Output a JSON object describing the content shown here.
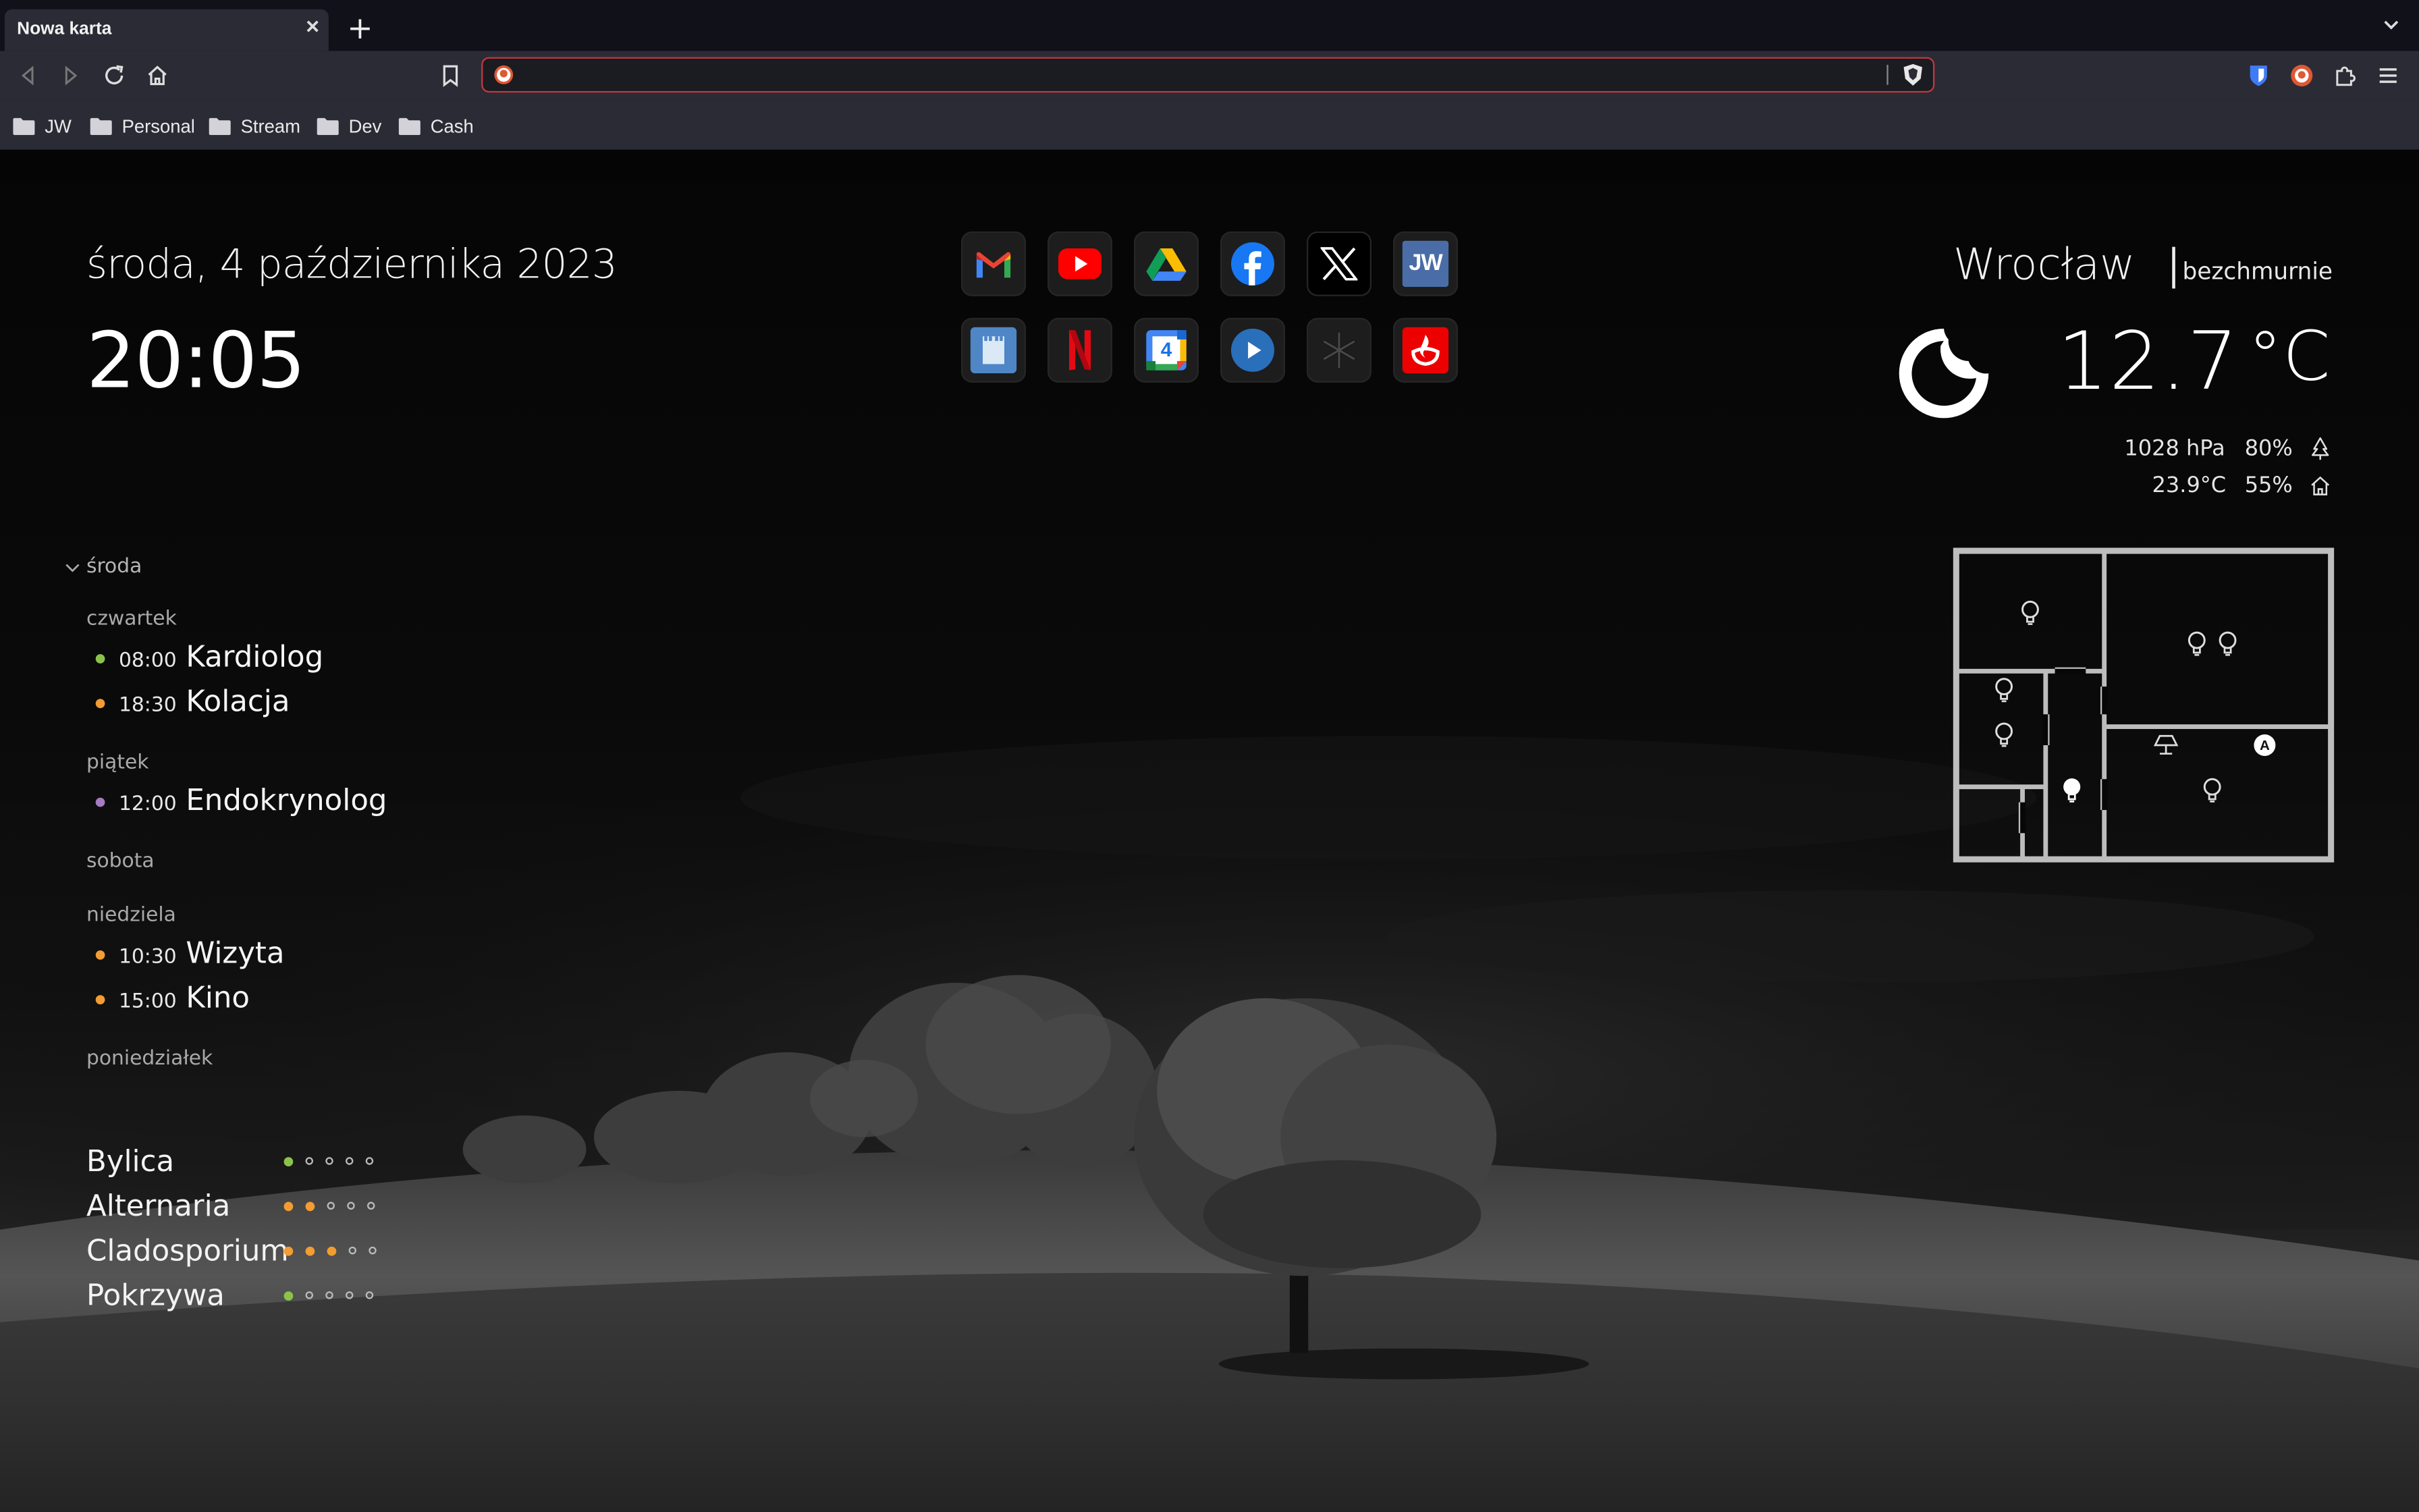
{
  "browser": {
    "tab_title": "Nowa karta",
    "tab_close": "×",
    "new_tab": "+",
    "address": {
      "value": "",
      "placeholder": ""
    },
    "bookmarks": [
      "JW",
      "Personal",
      "Stream",
      "Dev",
      "Cash"
    ]
  },
  "dashboard": {
    "date": "środa, 4 października 2023",
    "time": "20:05"
  },
  "calendar": {
    "today_label": "środa",
    "days": [
      {
        "label": "czwartek",
        "events": [
          {
            "time": "08:00",
            "title": "Kardiolog",
            "color": "#8bc34a"
          },
          {
            "time": "18:30",
            "title": "Kolacja",
            "color": "#f39c33"
          }
        ]
      },
      {
        "label": "piątek",
        "events": [
          {
            "time": "12:00",
            "title": "Endokrynolog",
            "color": "#a67bc2"
          }
        ]
      },
      {
        "label": "sobota",
        "events": []
      },
      {
        "label": "niedziela",
        "events": [
          {
            "time": "10:30",
            "title": "Wizyta",
            "color": "#f39c33"
          },
          {
            "time": "15:00",
            "title": "Kino",
            "color": "#f39c33"
          }
        ]
      },
      {
        "label": "poniedziałek",
        "events": []
      }
    ]
  },
  "pollen": [
    {
      "name": "Bylica",
      "level": 1,
      "max": 5,
      "color": "#8bc34a"
    },
    {
      "name": "Alternaria",
      "level": 2,
      "max": 5,
      "color": "#f39c33"
    },
    {
      "name": "Cladosporium",
      "level": 3,
      "max": 5,
      "color": "#f39c33"
    },
    {
      "name": "Pokrzywa",
      "level": 1,
      "max": 5,
      "color": "#8bc34a"
    }
  ],
  "shortcuts": {
    "row1": [
      "gmail-icon",
      "youtube-icon",
      "google-drive-icon",
      "facebook-icon",
      "x-icon",
      "jw-icon"
    ],
    "row2": [
      "home-app-icon",
      "netflix-icon",
      "google-calendar-icon",
      "player-icon",
      "snowflake-icon",
      "santander-icon"
    ],
    "calendar_day": "4",
    "jw_label": "JW"
  },
  "weather": {
    "city": "Wrocław",
    "condition": "bezchmurnie",
    "temperature": "12.7",
    "unit": "°C",
    "outdoor": {
      "pressure": "1028 hPa",
      "humidity": "80%"
    },
    "indoor": {
      "temperature": "23.9°C",
      "humidity": "55%"
    }
  },
  "floorplan": {
    "auto_badge": "A"
  }
}
